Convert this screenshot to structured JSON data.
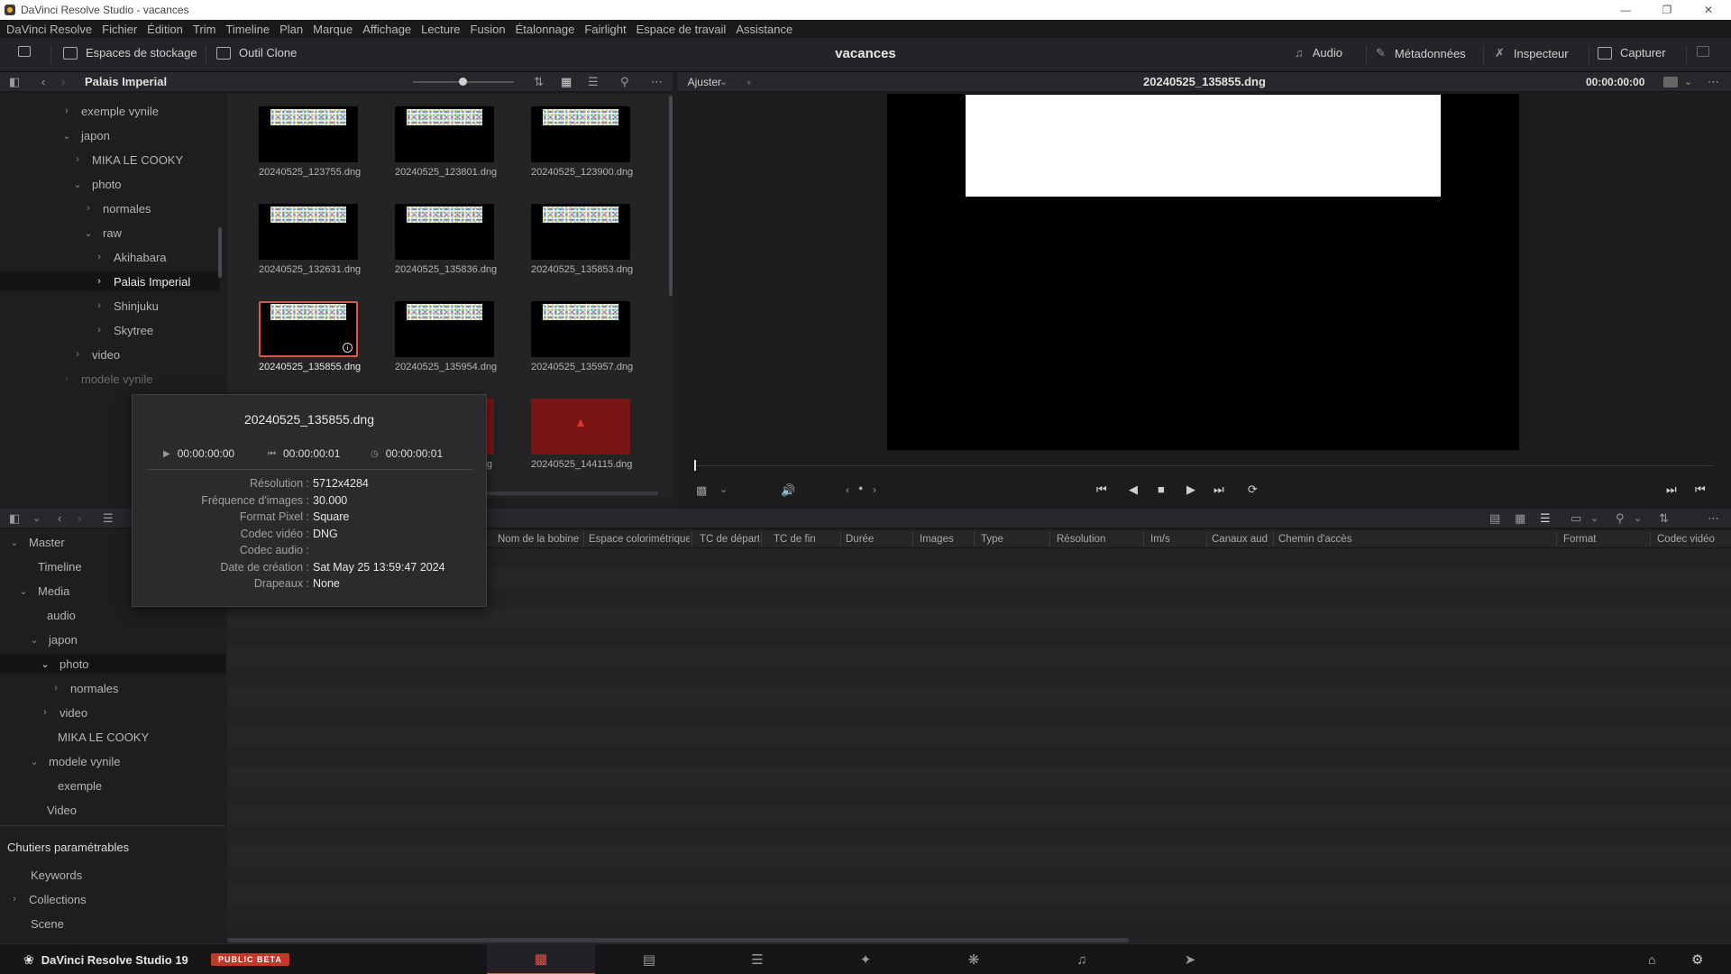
{
  "window": {
    "title": "DaVinci Resolve Studio - vacances",
    "controls": [
      "minimize",
      "maximize",
      "close"
    ]
  },
  "menu": [
    "DaVinci Resolve",
    "Fichier",
    "Édition",
    "Trim",
    "Timeline",
    "Plan",
    "Marque",
    "Affichage",
    "Lecture",
    "Fusion",
    "Étalonnage",
    "Fairlight",
    "Espace de travail",
    "Assistance"
  ],
  "toolbar": {
    "storage_label": "Espaces de stockage",
    "clone_label": "Outil Clone",
    "project_name": "vacances",
    "audio_label": "Audio",
    "metadata_label": "Métadonnées",
    "inspector_label": "Inspecteur",
    "capture_label": "Capturer"
  },
  "storage": {
    "current_folder": "Palais Imperial",
    "tree": [
      {
        "label": "exemple vynile",
        "expanded": false
      },
      {
        "label": "japon",
        "expanded": true
      },
      {
        "label": "MIKA LE COOKY",
        "expanded": false
      },
      {
        "label": "photo",
        "expanded": true
      },
      {
        "label": "normales",
        "expanded": false
      },
      {
        "label": "raw",
        "expanded": true
      },
      {
        "label": "Akihabara",
        "expanded": false
      },
      {
        "label": "Palais Imperial",
        "expanded": false,
        "selected": true
      },
      {
        "label": "Shinjuku",
        "expanded": false
      },
      {
        "label": "Skytree",
        "expanded": false
      },
      {
        "label": "video",
        "expanded": false
      },
      {
        "label": "modele vynile",
        "expanded": false
      }
    ]
  },
  "thumbnails": [
    {
      "name": "20240525_123755.dng"
    },
    {
      "name": "20240525_123801.dng"
    },
    {
      "name": "20240525_123900.dng"
    },
    {
      "name": "20240525_132631.dng"
    },
    {
      "name": "20240525_135836.dng"
    },
    {
      "name": "20240525_135853.dng"
    },
    {
      "name": "20240525_135855.dng",
      "selected": true
    },
    {
      "name": "20240525_135954.dng"
    },
    {
      "name": "20240525_135957.dng"
    },
    {
      "name": "20240525_144115.dng",
      "warning": true,
      "partial_left": "lg"
    }
  ],
  "viewer": {
    "zoom": "Ajuster",
    "clip_name": "20240525_135855.dng",
    "timecode": "00:00:00:00"
  },
  "popup": {
    "title": "20240525_135855.dng",
    "tc_in": "00:00:00:00",
    "tc_out": "00:00:00:01",
    "duration": "00:00:00:01",
    "meta": [
      {
        "k": "Résolution :",
        "v": "5712x4284"
      },
      {
        "k": "Fréquence d'images :",
        "v": "30.000"
      },
      {
        "k": "Format Pixel :",
        "v": "Square"
      },
      {
        "k": "Codec vidéo :",
        "v": "DNG"
      },
      {
        "k": "Codec audio :",
        "v": ""
      },
      {
        "k": "Date de création :",
        "v": "Sat May 25 13:59:47 2024"
      },
      {
        "k": "Drapeaux :",
        "v": "None"
      }
    ]
  },
  "bins": {
    "tree": [
      {
        "label": "Master",
        "expanded": true
      },
      {
        "label": "Timeline"
      },
      {
        "label": "Media",
        "expanded": true
      },
      {
        "label": "audio"
      },
      {
        "label": "japon",
        "expanded": true
      },
      {
        "label": "photo",
        "expanded": true,
        "selected": true
      },
      {
        "label": "normales",
        "expanded": false
      },
      {
        "label": "video",
        "expanded": false
      },
      {
        "label": "MIKA LE COOKY"
      },
      {
        "label": "modele vynile",
        "expanded": true
      },
      {
        "label": "exemple"
      },
      {
        "label": "Video"
      }
    ],
    "smart_title": "Chutiers paramétrables",
    "smart": [
      {
        "label": "Keywords"
      },
      {
        "label": "Collections",
        "expanded": false
      },
      {
        "label": "Scene"
      }
    ]
  },
  "pool": {
    "columns": [
      "Nom de la bobine",
      "Espace colorimétrique",
      "TC de départ",
      "TC de fin",
      "Durée",
      "Images",
      "Type",
      "Résolution",
      "Im/s",
      "Canaux aud",
      "Chemin d'accès",
      "Format",
      "Codec vidéo"
    ]
  },
  "footer": {
    "brand": "DaVinci Resolve Studio 19",
    "badge": "PUBLIC BETA",
    "pages": [
      "media",
      "cut",
      "edit",
      "fusion",
      "color",
      "fairlight",
      "deliver"
    ],
    "active_page": "media"
  },
  "colors": {
    "accent": "#e05545",
    "background": "#1e1e20"
  }
}
